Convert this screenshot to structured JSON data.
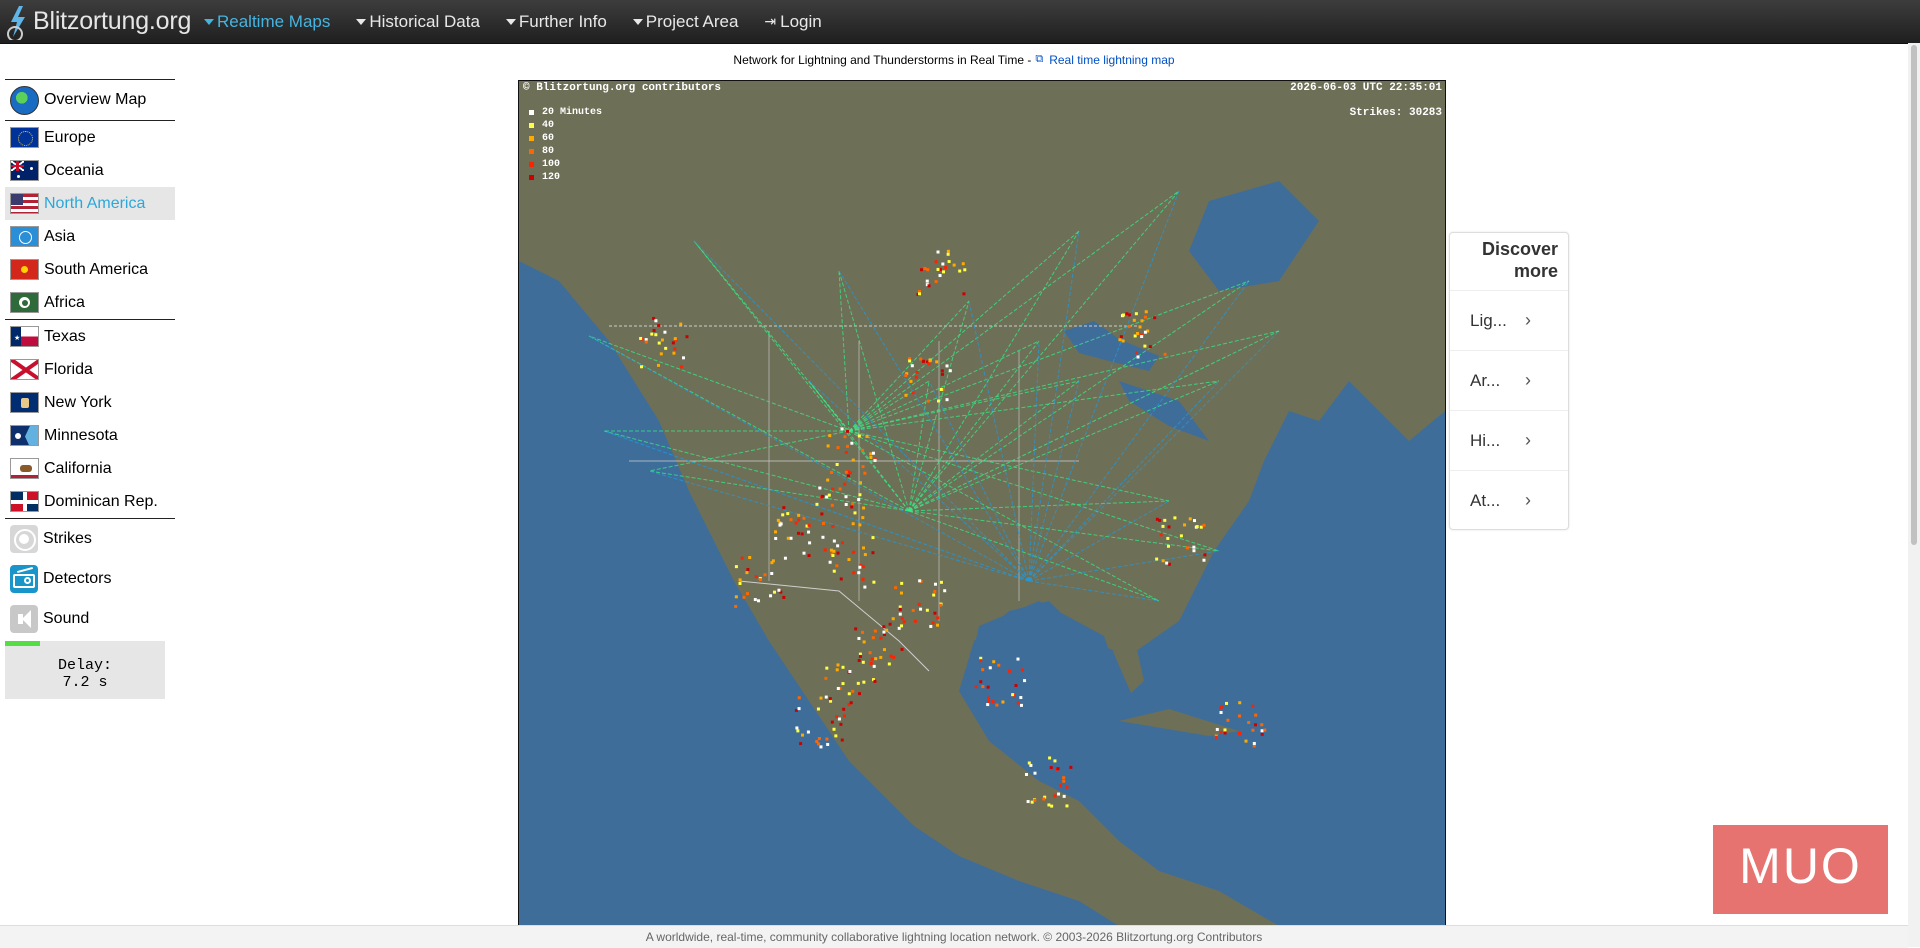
{
  "brand": {
    "name": "Blitzortung.org"
  },
  "nav": {
    "items": [
      {
        "label": "Realtime Maps",
        "active": true
      },
      {
        "label": "Historical Data",
        "active": false
      },
      {
        "label": "Further Info",
        "active": false
      },
      {
        "label": "Project Area",
        "active": false
      }
    ],
    "login_label": "Login"
  },
  "subtitle": {
    "text": "Network for Lightning and Thunderstorms in Real Time -",
    "link_label": "Real time lightning map"
  },
  "sidebar": {
    "overview_label": "Overview Map",
    "regions": [
      "Europe",
      "Oceania",
      "North America",
      "Asia",
      "South America",
      "Africa"
    ],
    "active_region": "North America",
    "states": [
      "Texas",
      "Florida",
      "New York",
      "Minnesota",
      "California",
      "Dominican Rep."
    ],
    "tools": [
      "Strikes",
      "Detectors",
      "Sound"
    ]
  },
  "delay": {
    "label": "Delay:",
    "value": "7.2 s",
    "progress": 0.22
  },
  "map": {
    "credit": "© Blitzortung.org contributors",
    "timestamp": "2026-06-03 UTC 22:35:01",
    "strikes_label": "Strikes: 30283",
    "legend": [
      {
        "label": "20 Minutes",
        "color": "#ffffff"
      },
      {
        "label": "40",
        "color": "#ffff44"
      },
      {
        "label": "60",
        "color": "#ffaa00"
      },
      {
        "label": "80",
        "color": "#ff6600"
      },
      {
        "label": "100",
        "color": "#ff2200"
      },
      {
        "label": "120",
        "color": "#cc0000"
      }
    ],
    "colors": {
      "ocean": "#3f6d99",
      "land": "#6e6f57",
      "station_lines": "#33ee88",
      "detector_lines": "#2299dd"
    }
  },
  "discover": {
    "title_line1": "Discover",
    "title_line2": "more",
    "items": [
      "Lig...",
      "Ar...",
      "Hi...",
      "At..."
    ]
  },
  "watermark": {
    "text": "MUO"
  },
  "footer": {
    "text": "A worldwide, real-time, community collaborative lightning location network. © 2003-2026 Blitzortung.org Contributors"
  }
}
